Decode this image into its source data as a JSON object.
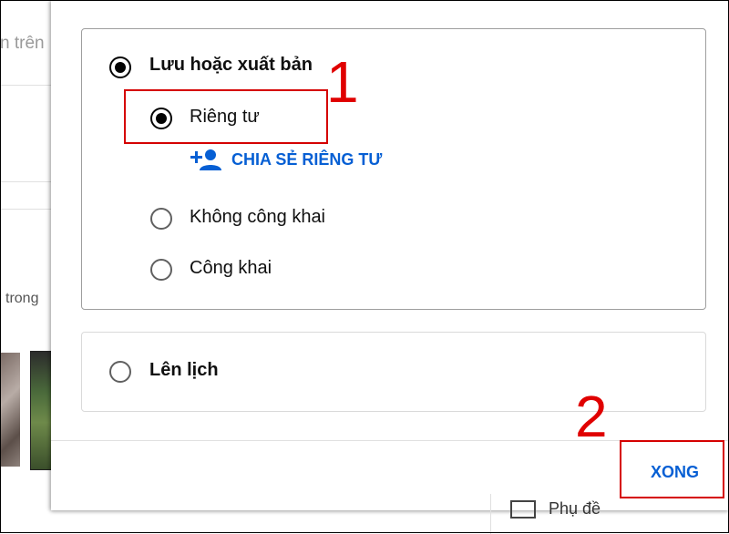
{
  "background": {
    "search_partial": "n trên",
    "text_partial": "trong"
  },
  "visibility": {
    "group_title": "Lưu hoặc xuất bản",
    "options": [
      {
        "label": "Riêng tư",
        "selected": true
      },
      {
        "label": "Không công khai",
        "selected": false
      },
      {
        "label": "Công khai",
        "selected": false
      }
    ],
    "share_link": "CHIA SẺ RIÊNG TƯ",
    "share_icon": "person-add-icon"
  },
  "schedule": {
    "label": "Lên lịch",
    "selected": false
  },
  "footer": {
    "done_label": "XONG"
  },
  "annotations": {
    "marker1": "1",
    "marker2": "2",
    "color": "#d50000"
  },
  "bottom_partial": {
    "label": "Phụ đề"
  },
  "colors": {
    "accent": "#065fd4",
    "annotation": "#d50000"
  }
}
